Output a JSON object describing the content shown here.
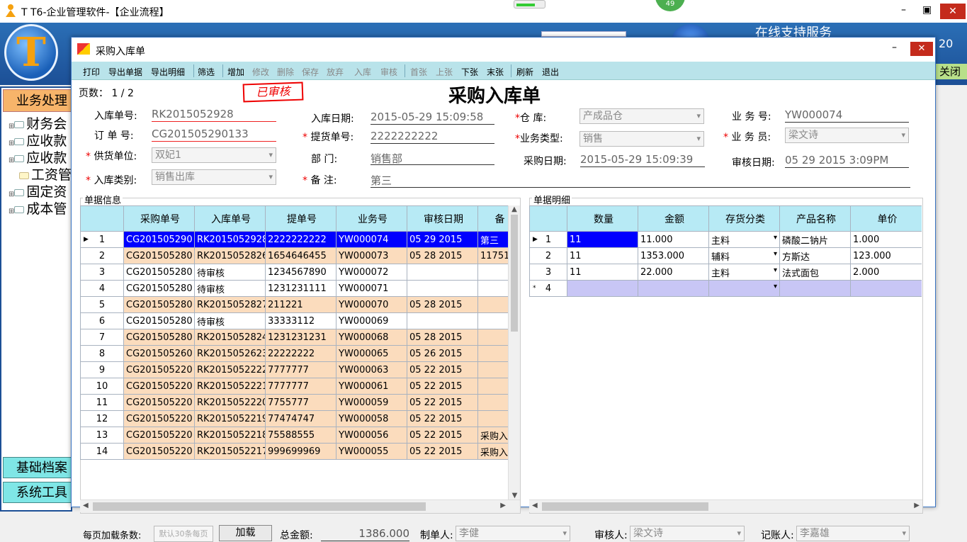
{
  "app": {
    "title": "T T6-企业管理软件-【企业流程】",
    "online_support": "在线支持服务",
    "banner_number": "20",
    "banner_close": "关闭",
    "badge": "49",
    "min": "–",
    "max": "▣",
    "close": "✕"
  },
  "nav": {
    "business": "业务处理",
    "items": [
      "财务会",
      "应收款",
      "应收款",
      "工资管",
      "固定资",
      "成本管"
    ],
    "basic": "基础档案",
    "system": "系统工具"
  },
  "window": {
    "title": "采购入库单",
    "min": "–",
    "max": "□",
    "close": "✕"
  },
  "toolbar": [
    "打印",
    "导出单据",
    "导出明细",
    "筛选",
    "增加",
    "修改",
    "删除",
    "保存",
    "放弃",
    "入库",
    "审核",
    "首张",
    "上张",
    "下张",
    "末张",
    "刷新",
    "退出"
  ],
  "toolbar_disabled": [
    false,
    false,
    false,
    false,
    false,
    true,
    true,
    true,
    true,
    true,
    true,
    true,
    true,
    false,
    false,
    false,
    false
  ],
  "form": {
    "pages_label": "页数：",
    "pages_value": "1 / 2",
    "stamp": "已审核",
    "page_title": "采购入库单",
    "receipt_no_label": "入库单号:",
    "receipt_no": "RK2015052928",
    "order_no_label": "订 单 号:",
    "order_no": "CG201505290133",
    "supplier_label": "供货单位:",
    "supplier": "双妃1",
    "receipt_type_label": "入库类别:",
    "receipt_type": "销售出库",
    "receipt_date_label": "入库日期:",
    "receipt_date": "2015-05-29 15:09:58",
    "pickup_no_label": "提货单号:",
    "pickup_no": "2222222222",
    "dept_label": "部    门:",
    "dept": "销售部",
    "remark_label": "备    注:",
    "remark": "第三",
    "warehouse_label": "仓    库:",
    "warehouse": "产成品仓",
    "biz_type_label": "业务类型:",
    "biz_type": "销售",
    "purchase_date_label": "采购日期:",
    "purchase_date": "2015-05-29 15:09:39",
    "biz_no_label": "业 务 号:",
    "biz_no": "YW000074",
    "clerk_label": "业 务 员:",
    "clerk": "梁文诗",
    "audit_date_label": "审核日期:",
    "audit_date": "05 29 2015  3:09PM"
  },
  "left_grid": {
    "label": "单据信息",
    "columns": [
      "采购单号",
      "入库单号",
      "提单号",
      "业务号",
      "审核日期",
      "备"
    ],
    "rows": [
      [
        "1",
        "CG201505290",
        "RK2015052928",
        "2222222222",
        "YW000074",
        "05 29 2015",
        "第三"
      ],
      [
        "2",
        "CG201505280",
        "RK2015052826",
        "1654646455",
        "YW000073",
        "05 28 2015",
        "11751"
      ],
      [
        "3",
        "CG201505280",
        "待审核",
        "1234567890",
        "YW000072",
        "",
        ""
      ],
      [
        "4",
        "CG201505280",
        "待审核",
        "1231231111",
        "YW000071",
        "",
        ""
      ],
      [
        "5",
        "CG201505280",
        "RK2015052827",
        "211221",
        "YW000070",
        "05 28 2015",
        ""
      ],
      [
        "6",
        "CG201505280",
        "待审核",
        "33333112",
        "YW000069",
        "",
        ""
      ],
      [
        "7",
        "CG201505280",
        "RK2015052824",
        "1231231231",
        "YW000068",
        "05 28 2015",
        ""
      ],
      [
        "8",
        "CG201505260",
        "RK2015052623",
        "22222222",
        "YW000065",
        "05 26 2015",
        ""
      ],
      [
        "9",
        "CG201505220",
        "RK2015052222",
        "7777777",
        "YW000063",
        "05 22 2015",
        ""
      ],
      [
        "10",
        "CG201505220",
        "RK2015052221",
        "7777777",
        "YW000061",
        "05 22 2015",
        ""
      ],
      [
        "11",
        "CG201505220",
        "RK2015052220",
        "7755777",
        "YW000059",
        "05 22 2015",
        ""
      ],
      [
        "12",
        "CG201505220",
        "RK2015052219",
        "77474747",
        "YW000058",
        "05 22 2015",
        ""
      ],
      [
        "13",
        "CG201505220",
        "RK2015052218",
        "75588555",
        "YW000056",
        "05 22 2015",
        "采购入"
      ],
      [
        "14",
        "CG201505220",
        "RK2015052217",
        "999699969",
        "YW000055",
        "05 22 2015",
        "采购入"
      ]
    ]
  },
  "right_grid": {
    "label": "单据明细",
    "columns": [
      "数量",
      "金额",
      "存货分类",
      "产品名称",
      "单价"
    ],
    "rows": [
      [
        "1",
        "11",
        "11.000",
        "主料",
        "磷酸二钠片",
        "1.000"
      ],
      [
        "2",
        "11",
        "1353.000",
        "辅料",
        "方斯达",
        "123.000"
      ],
      [
        "3",
        "11",
        "22.000",
        "主料",
        "法式面包",
        "2.000"
      ],
      [
        "4",
        "",
        "",
        "",
        "",
        ""
      ]
    ]
  },
  "bottom": {
    "perpage_label": "每页加载条数:",
    "perpage_placeholder": "默认30条每页",
    "load": "加载",
    "total_label": "总金额:",
    "total": "1386.000",
    "maker_label": "制单人:",
    "maker": "李健",
    "auditor_label": "审核人:",
    "auditor": "梁文诗",
    "bookkeeper_label": "记账人:",
    "bookkeeper": "李嘉雄"
  }
}
